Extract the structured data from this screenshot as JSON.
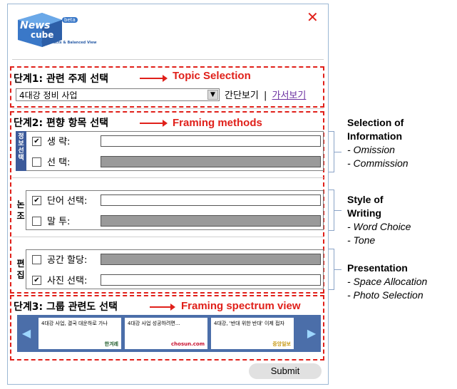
{
  "window": {
    "close_icon": "close-x-icon",
    "close_color": "#e0201a"
  },
  "logo": {
    "brand": "News",
    "brand2": "cube",
    "badge": "beta",
    "tagline": "Rich Facts & Balanced View"
  },
  "step1": {
    "title": "단계1: 관련 주제 선택",
    "label": "Topic Selection",
    "topic_value": "4대강 정비 사업",
    "view_simple": "간단보기",
    "divider": "|",
    "view_headline": "가서보기"
  },
  "step2": {
    "title": "단계2: 편향 항목 선택",
    "label": "Framing methods",
    "groups": [
      {
        "tag": "정보선택",
        "rows": [
          {
            "label": "생 략:",
            "checked": true
          },
          {
            "label": "선 택:",
            "checked": false
          }
        ]
      },
      {
        "tag": "논조",
        "rows": [
          {
            "label": "단어 선택:",
            "checked": true
          },
          {
            "label": "말 투:",
            "checked": false
          }
        ]
      },
      {
        "tag": "편집",
        "rows": [
          {
            "label": "공간 할당:",
            "checked": false
          },
          {
            "label": "사진 선택:",
            "checked": true
          }
        ]
      }
    ]
  },
  "step3": {
    "title": "단계3: 그룹 관련도 선택",
    "label": "Framing spectrum view",
    "cards": [
      {
        "text": "4대강 사업, 결국 대운하로 가나",
        "source": "한겨레"
      },
      {
        "text": "4대강 사업 성공하려면...",
        "source": "chosun.com"
      },
      {
        "text": "4대강, '반대 위한 반대' 이제 접자",
        "source": "중앙일보"
      }
    ]
  },
  "submit_label": "Submit",
  "annotations": [
    {
      "title": "Selection of Information",
      "items": [
        "- Omission",
        "- Commission"
      ]
    },
    {
      "title": "Style of Writing",
      "items": [
        "- Word Choice",
        "- Tone"
      ]
    },
    {
      "title": "Presentation",
      "items": [
        "- Space Allocation",
        "- Photo Selection"
      ]
    }
  ],
  "colors": {
    "accent_red": "#e0201a",
    "carousel_blue": "#4b6ea9",
    "group_tag_blue": "#3c5a9a"
  }
}
